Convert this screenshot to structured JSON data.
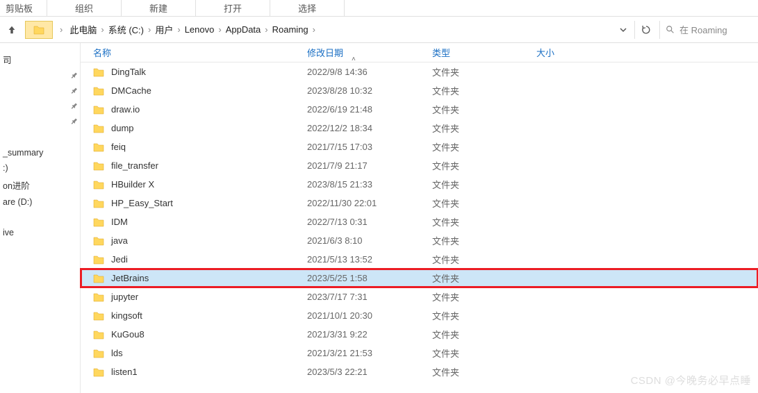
{
  "ribbon": {
    "tabs": [
      "剪贴板",
      "组织",
      "新建",
      "打开",
      "选择"
    ]
  },
  "breadcrumb": {
    "segments": [
      "此电脑",
      "系统 (C:)",
      "用户",
      "Lenovo",
      "AppData",
      "Roaming"
    ]
  },
  "search": {
    "placeholder": "在 Roaming"
  },
  "columns": {
    "name": "名称",
    "date": "修改日期",
    "type": "类型",
    "size": "大小"
  },
  "sidebar": {
    "items": [
      {
        "label": "司",
        "pin": false,
        "sub": false
      },
      {
        "label": "",
        "pin": true,
        "sub": true
      },
      {
        "label": "",
        "pin": true,
        "sub": true
      },
      {
        "label": "",
        "pin": true,
        "sub": true
      },
      {
        "label": "",
        "pin": true,
        "sub": true
      },
      {
        "label": "",
        "pin": false,
        "sub": false
      },
      {
        "label": "_summary",
        "pin": false,
        "sub": false
      },
      {
        "label": ":)",
        "pin": false,
        "sub": false
      },
      {
        "label": "on进阶",
        "pin": false,
        "sub": false
      },
      {
        "label": "are (D:)",
        "pin": false,
        "sub": false
      },
      {
        "label": "",
        "pin": false,
        "sub": false
      },
      {
        "label": "ive",
        "pin": false,
        "sub": false
      }
    ]
  },
  "files": [
    {
      "name": "DingTalk",
      "date": "2022/9/8 14:36",
      "type": "文件夹",
      "selected": false,
      "highlighted": false
    },
    {
      "name": "DMCache",
      "date": "2023/8/28 10:32",
      "type": "文件夹",
      "selected": false,
      "highlighted": false
    },
    {
      "name": "draw.io",
      "date": "2022/6/19 21:48",
      "type": "文件夹",
      "selected": false,
      "highlighted": false
    },
    {
      "name": "dump",
      "date": "2022/12/2 18:34",
      "type": "文件夹",
      "selected": false,
      "highlighted": false
    },
    {
      "name": "feiq",
      "date": "2021/7/15 17:03",
      "type": "文件夹",
      "selected": false,
      "highlighted": false
    },
    {
      "name": "file_transfer",
      "date": "2021/7/9 21:17",
      "type": "文件夹",
      "selected": false,
      "highlighted": false
    },
    {
      "name": "HBuilder X",
      "date": "2023/8/15 21:33",
      "type": "文件夹",
      "selected": false,
      "highlighted": false
    },
    {
      "name": "HP_Easy_Start",
      "date": "2022/11/30 22:01",
      "type": "文件夹",
      "selected": false,
      "highlighted": false
    },
    {
      "name": "IDM",
      "date": "2022/7/13 0:31",
      "type": "文件夹",
      "selected": false,
      "highlighted": false
    },
    {
      "name": "java",
      "date": "2021/6/3 8:10",
      "type": "文件夹",
      "selected": false,
      "highlighted": false
    },
    {
      "name": "Jedi",
      "date": "2021/5/13 13:52",
      "type": "文件夹",
      "selected": false,
      "highlighted": false
    },
    {
      "name": "JetBrains",
      "date": "2023/5/25 1:58",
      "type": "文件夹",
      "selected": true,
      "highlighted": true
    },
    {
      "name": "jupyter",
      "date": "2023/7/17 7:31",
      "type": "文件夹",
      "selected": false,
      "highlighted": false
    },
    {
      "name": "kingsoft",
      "date": "2021/10/1 20:30",
      "type": "文件夹",
      "selected": false,
      "highlighted": false
    },
    {
      "name": "KuGou8",
      "date": "2021/3/31 9:22",
      "type": "文件夹",
      "selected": false,
      "highlighted": false
    },
    {
      "name": "lds",
      "date": "2021/3/21 21:53",
      "type": "文件夹",
      "selected": false,
      "highlighted": false
    },
    {
      "name": "listen1",
      "date": "2023/5/3 22:21",
      "type": "文件夹",
      "selected": false,
      "highlighted": false
    }
  ],
  "watermark": "CSDN @今晚务必早点睡"
}
